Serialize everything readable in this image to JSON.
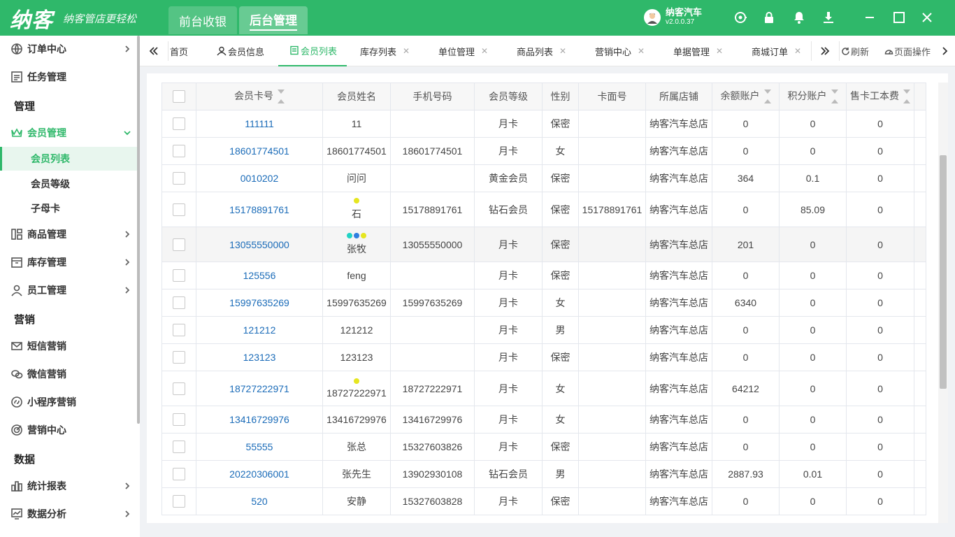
{
  "app": {
    "logo": "纳客",
    "slogan": "纳客管店更轻松",
    "nav_tabs": [
      "前台收银",
      "后台管理"
    ],
    "user_name": "纳客汽车",
    "version": "v2.0.0.37",
    "brand_color": "#2fb86a"
  },
  "sidebar": {
    "items": {
      "order": "订单中心",
      "task": "任务管理",
      "group_manage": "管理",
      "member": "会员管理",
      "member_list": "会员列表",
      "member_level": "会员等级",
      "sub_card": "子母卡",
      "goods": "商品管理",
      "stock": "库存管理",
      "staff": "员工管理",
      "group_marketing": "营销",
      "sms": "短信营销",
      "wechat": "微信营销",
      "miniapp": "小程序营销",
      "marketing_center": "营销中心",
      "group_data": "数据",
      "report": "统计报表",
      "analysis": "数据分析"
    }
  },
  "tabs": {
    "home": "首页",
    "member_info": "会员信息",
    "member_list": "会员列表",
    "stock_list": "库存列表",
    "unit": "单位管理",
    "goods_list": "商品列表",
    "marketing": "营销中心",
    "bills": "单据管理",
    "mall_orders": "商城订单",
    "refresh": "刷新",
    "page_ops": "页面操作",
    "close_mark": "✕"
  },
  "table": {
    "headers": [
      "会员卡号",
      "会员姓名",
      "手机号码",
      "会员等级",
      "性别",
      "卡面号",
      "所属店铺",
      "余额账户",
      "积分账户",
      "售卡工本费"
    ],
    "rows": [
      {
        "card": "111111",
        "name": "11",
        "phone": "",
        "level": "月卡",
        "gender": "保密",
        "face": "",
        "store": "纳客汽车总店",
        "balance": "0",
        "points": "0",
        "fee": "0"
      },
      {
        "card": "18601774501",
        "name": "18601774501",
        "phone": "18601774501",
        "level": "月卡",
        "gender": "女",
        "face": "",
        "store": "纳客汽车总店",
        "balance": "0",
        "points": "0",
        "fee": "0"
      },
      {
        "card": "0010202",
        "name": "问问",
        "phone": "",
        "level": "黄金会员",
        "gender": "保密",
        "face": "",
        "store": "纳客汽车总店",
        "balance": "364",
        "points": "0.1",
        "fee": "0"
      },
      {
        "card": "15178891761",
        "name": "石",
        "phone": "15178891761",
        "level": "钻石会员",
        "gender": "保密",
        "face": "15178891761",
        "store": "纳客汽车总店",
        "balance": "0",
        "points": "85.09",
        "fee": "0"
      },
      {
        "card": "13055550000",
        "name": "张牧",
        "phone": "13055550000",
        "level": "月卡",
        "gender": "保密",
        "face": "",
        "store": "纳客汽车总店",
        "balance": "201",
        "points": "0",
        "fee": "0"
      },
      {
        "card": "125556",
        "name": "feng",
        "phone": "",
        "level": "月卡",
        "gender": "保密",
        "face": "",
        "store": "纳客汽车总店",
        "balance": "0",
        "points": "0",
        "fee": "0"
      },
      {
        "card": "15997635269",
        "name": "15997635269",
        "phone": "15997635269",
        "level": "月卡",
        "gender": "女",
        "face": "",
        "store": "纳客汽车总店",
        "balance": "6340",
        "points": "0",
        "fee": "0"
      },
      {
        "card": "121212",
        "name": "121212",
        "phone": "",
        "level": "月卡",
        "gender": "男",
        "face": "",
        "store": "纳客汽车总店",
        "balance": "0",
        "points": "0",
        "fee": "0"
      },
      {
        "card": "123123",
        "name": "123123",
        "phone": "",
        "level": "月卡",
        "gender": "保密",
        "face": "",
        "store": "纳客汽车总店",
        "balance": "0",
        "points": "0",
        "fee": "0"
      },
      {
        "card": "18727222971",
        "name": "18727222971",
        "phone": "18727222971",
        "level": "月卡",
        "gender": "女",
        "face": "",
        "store": "纳客汽车总店",
        "balance": "64212",
        "points": "0",
        "fee": "0"
      },
      {
        "card": "13416729976",
        "name": "13416729976",
        "phone": "13416729976",
        "level": "月卡",
        "gender": "女",
        "face": "",
        "store": "纳客汽车总店",
        "balance": "0",
        "points": "0",
        "fee": "0"
      },
      {
        "card": "55555",
        "name": "张总",
        "phone": "15327603826",
        "level": "月卡",
        "gender": "保密",
        "face": "",
        "store": "纳客汽车总店",
        "balance": "0",
        "points": "0",
        "fee": "0"
      },
      {
        "card": "20220306001",
        "name": "张先生",
        "phone": "13902930108",
        "level": "钻石会员",
        "gender": "男",
        "face": "",
        "store": "纳客汽车总店",
        "balance": "2887.93",
        "points": "0.01",
        "fee": "0"
      },
      {
        "card": "520",
        "name": "安静",
        "phone": "15327603828",
        "level": "月卡",
        "gender": "保密",
        "face": "",
        "store": "纳客汽车总店",
        "balance": "0",
        "points": "0",
        "fee": "0"
      }
    ],
    "dot_colors": {
      "yellow": "#e6e620",
      "cyan": "#22d3c5",
      "blue": "#2f7fe0"
    }
  }
}
